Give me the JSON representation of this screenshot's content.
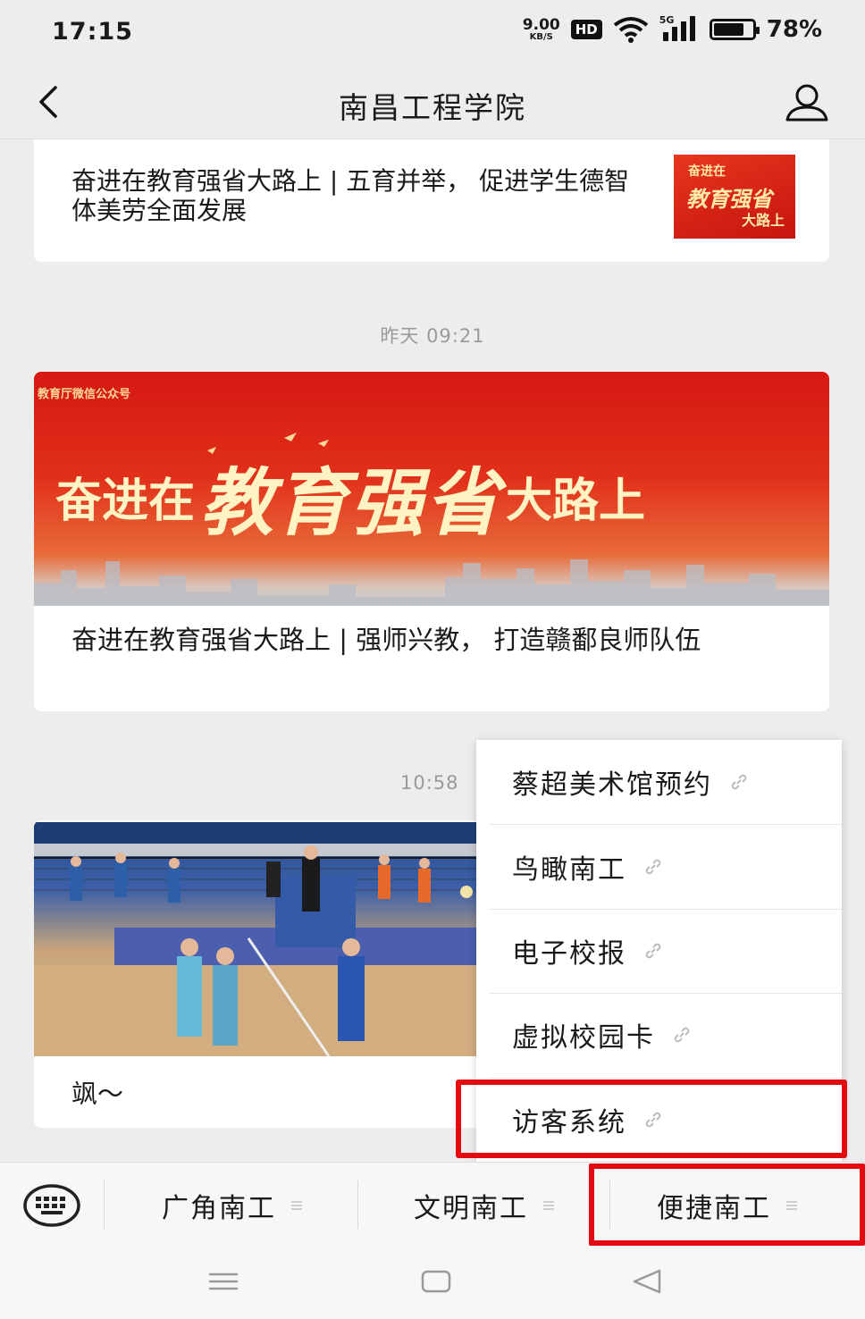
{
  "status_bar": {
    "time": "17:15",
    "net_speed_value": "9.00",
    "net_speed_unit": "KB/S",
    "hd_badge": "HD",
    "signal_label": "5G",
    "battery_percent": "78%",
    "battery_level": 0.78
  },
  "header": {
    "title": "南昌工程学院",
    "back_icon": "chevron-left-icon",
    "profile_icon": "person-icon"
  },
  "articles": [
    {
      "title": "奋进在教育强省大路上 | 五育并举， 促进学生德智体美劳全面发展",
      "thumbnail_text": [
        "奋进在",
        "教育强省",
        "大路上"
      ]
    },
    {
      "timestamp": "昨天 09:21",
      "banner_source": "教育厅微信公众号",
      "banner_text_a": "奋进在",
      "banner_text_b": "教育强省",
      "banner_text_c": "大路上",
      "title": "奋进在教育强省大路上 | 强师兴教， 打造赣鄱良师队伍"
    },
    {
      "timestamp": "10:58",
      "title": "飒～"
    }
  ],
  "popup_menu": {
    "items": [
      {
        "label": "蔡超美术馆预约",
        "icon": "link-icon"
      },
      {
        "label": "鸟瞰南工",
        "icon": "link-icon"
      },
      {
        "label": "电子校报",
        "icon": "link-icon"
      },
      {
        "label": "虚拟校园卡",
        "icon": "link-icon"
      },
      {
        "label": "访客系统",
        "icon": "link-icon"
      }
    ]
  },
  "bottom_menu": {
    "keyboard_icon": "keyboard-icon",
    "tabs": [
      {
        "label": "广角南工"
      },
      {
        "label": "文明南工"
      },
      {
        "label": "便捷南工"
      }
    ]
  },
  "colors": {
    "background": "#ededed",
    "highlight": "#e40a12",
    "banner_red": "#d51813"
  }
}
